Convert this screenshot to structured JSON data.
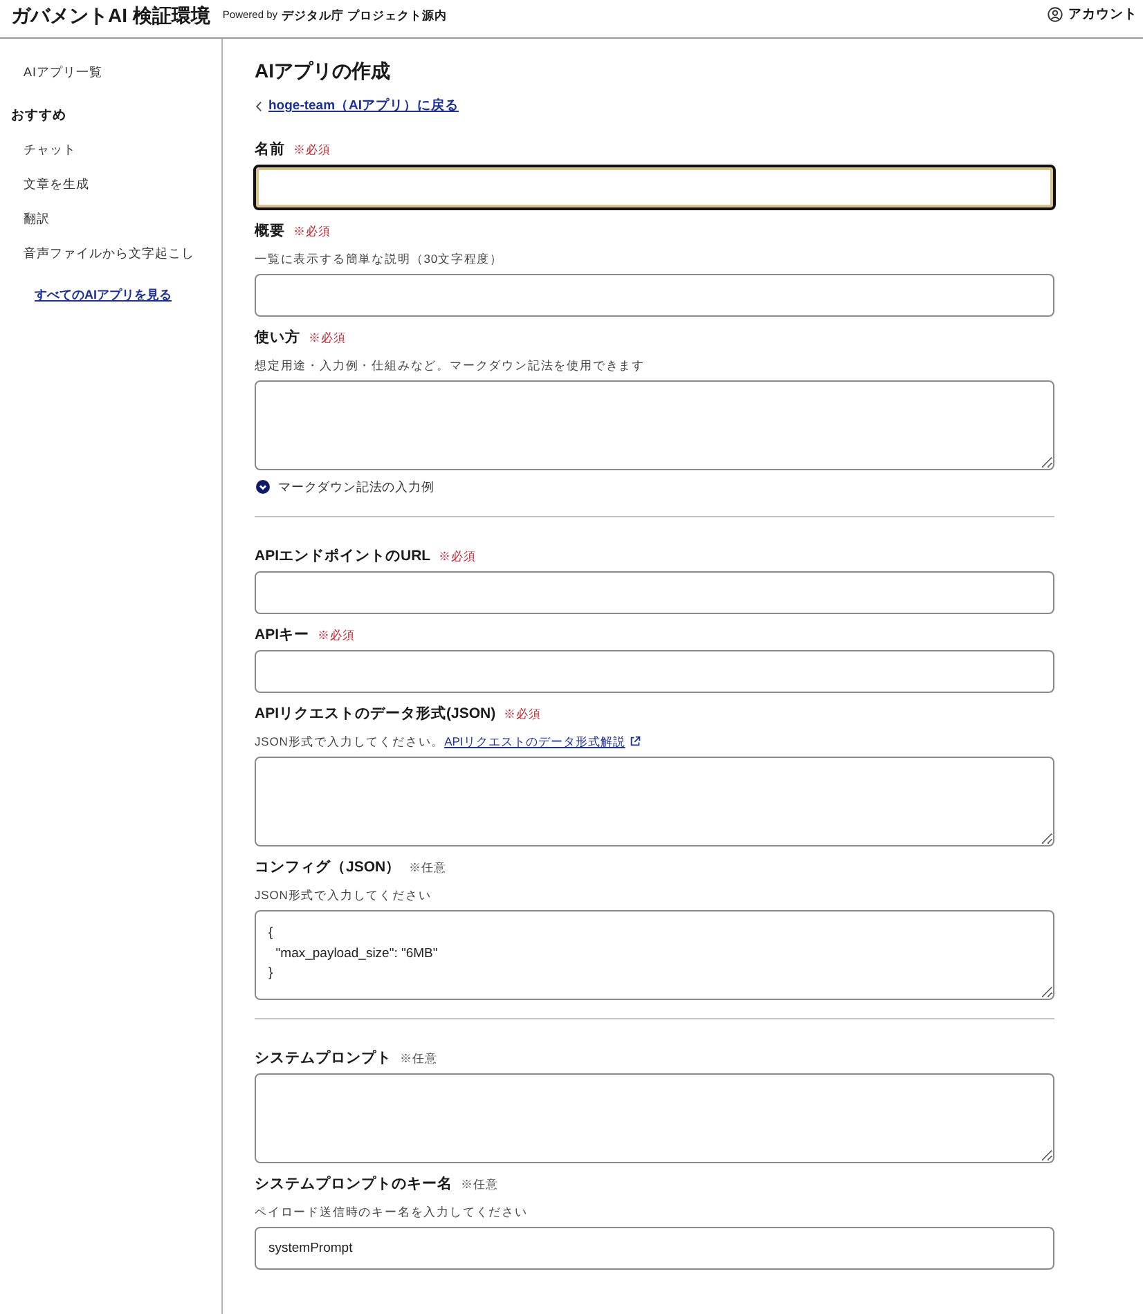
{
  "header": {
    "title": "ガバメントAI 検証環境",
    "powered_by": "Powered by",
    "organization": "デジタル庁 プロジェクト源内",
    "account": "アカウント"
  },
  "sidebar": {
    "items": [
      {
        "kind": "item",
        "label": "AIアプリ一覧"
      },
      {
        "kind": "heading",
        "label": "おすすめ"
      },
      {
        "kind": "item",
        "label": "チャット"
      },
      {
        "kind": "item",
        "label": "文章を生成"
      },
      {
        "kind": "item",
        "label": "翻訳"
      },
      {
        "kind": "item",
        "label": "音声ファイルから文字起こし"
      },
      {
        "kind": "more_link",
        "label": "すべてのAIアプリを見る"
      }
    ]
  },
  "page": {
    "title": "AIアプリの作成",
    "back_link": "hoge-team（AIアプリ）に戻る"
  },
  "form": {
    "items": [
      {
        "kind": "input",
        "label": "名前",
        "requirement": "※必須",
        "required": true,
        "focused": true
      },
      {
        "kind": "input",
        "label": "概要",
        "requirement": "※必須",
        "required": true,
        "description": "一覧に表示する簡単な説明（30文字程度）",
        "focused": false
      },
      {
        "kind": "textarea",
        "label": "使い方",
        "requirement": "※必須",
        "required": true,
        "description": "想定用途・入力例・仕組みなど。マークダウン記法を使用できます",
        "focused": false
      },
      {
        "kind": "disclosure",
        "label": "マークダウン記法の入力例",
        "expanded": false
      },
      {
        "kind": "divider"
      },
      {
        "kind": "input",
        "label": "APIエンドポイントのURL",
        "requirement": "※必須",
        "required": true,
        "focused": false
      },
      {
        "kind": "input",
        "label": "APIキー",
        "requirement": "※必須",
        "required": true,
        "focused": false
      },
      {
        "kind": "textarea",
        "label": "APIリクエストのデータ形式(JSON)",
        "requirement": "※必須",
        "required": true,
        "description": "JSON形式で入力してください。",
        "description_link": "APIリクエストのデータ形式解説",
        "focused": false
      },
      {
        "kind": "textarea",
        "label": "コンフィグ（JSON）",
        "requirement": "※任意",
        "required": false,
        "description": "JSON形式で入力してください",
        "value": "{\n  \"max_payload_size\": \"6MB\"\n}",
        "focused": false
      },
      {
        "kind": "divider"
      },
      {
        "kind": "textarea",
        "label": "システムプロンプト",
        "requirement": "※任意",
        "required": false,
        "focused": false
      },
      {
        "kind": "input",
        "label": "システムプロンプトのキー名",
        "requirement": "※任意",
        "required": false,
        "description": "ペイロード送信時のキー名を入力してください",
        "value": "systemPrompt",
        "focused": false
      }
    ]
  }
}
